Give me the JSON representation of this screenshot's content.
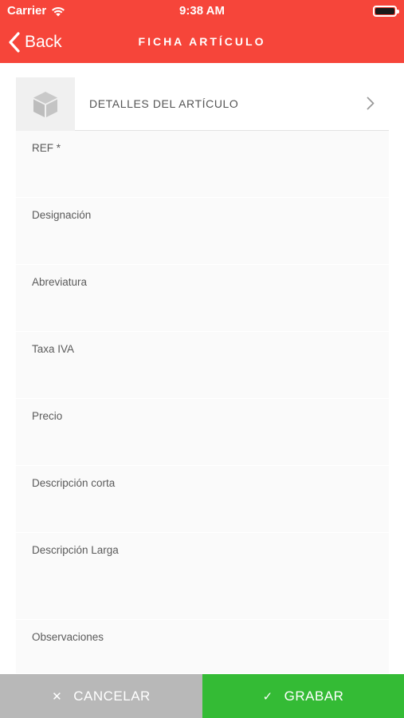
{
  "status_bar": {
    "carrier": "Carrier",
    "time": "9:38 AM"
  },
  "nav": {
    "back_label": "Back",
    "title": "FICHA ARTÍCULO"
  },
  "details_row": {
    "label": "DETALLES DEL ARTÍCULO",
    "icon": "box-icon"
  },
  "fields": [
    {
      "key": "ref",
      "label": "REF *",
      "value": ""
    },
    {
      "key": "designacion",
      "label": "Designación",
      "value": ""
    },
    {
      "key": "abreviatura",
      "label": "Abreviatura",
      "value": ""
    },
    {
      "key": "taxa-iva",
      "label": "Taxa IVA",
      "value": ""
    },
    {
      "key": "precio",
      "label": "Precio",
      "value": ""
    },
    {
      "key": "descripcion-corta",
      "label": "Descripción corta",
      "value": ""
    },
    {
      "key": "descripcion-larga",
      "label": "Descripción Larga",
      "value": ""
    },
    {
      "key": "observaciones",
      "label": "Observaciones",
      "value": ""
    }
  ],
  "footer": {
    "cancel_label": "CANCELAR",
    "save_label": "GRABAR"
  },
  "colors": {
    "header": "#f6453a",
    "cancel": "#b8b8b8",
    "save": "#34bb35"
  }
}
